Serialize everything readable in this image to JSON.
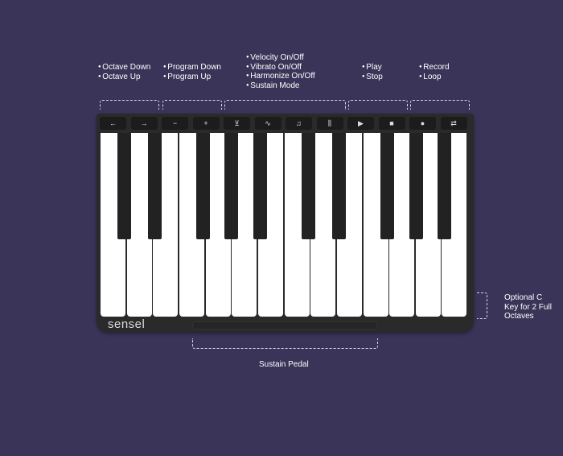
{
  "labels": {
    "octave": [
      "Octave Down",
      "Octave Up"
    ],
    "program": [
      "Program Down",
      "Program Up"
    ],
    "modes": [
      "Velocity On/Off",
      "Vibrato On/Off",
      "Harmonize On/Off",
      "Sustain Mode"
    ],
    "transport": [
      "Play",
      "Stop"
    ],
    "record": [
      "Record",
      "Loop"
    ],
    "optional_c": [
      "Optional C",
      "Key for 2 Full",
      "Octaves"
    ],
    "sustain_pedal": "Sustain Pedal"
  },
  "buttons": [
    {
      "icon": "arrow-left-icon",
      "glyph": "←"
    },
    {
      "icon": "arrow-right-icon",
      "glyph": "→"
    },
    {
      "icon": "minus-icon",
      "glyph": "−"
    },
    {
      "icon": "plus-icon",
      "glyph": "+"
    },
    {
      "icon": "velocity-icon",
      "glyph": "⊻"
    },
    {
      "icon": "vibrato-icon",
      "glyph": "∿"
    },
    {
      "icon": "harmonize-icon",
      "glyph": "♫"
    },
    {
      "icon": "sustain-icon",
      "glyph": "⫼"
    },
    {
      "icon": "play-icon",
      "glyph": "▶"
    },
    {
      "icon": "stop-icon",
      "glyph": "■"
    },
    {
      "icon": "record-icon",
      "glyph": "●"
    },
    {
      "icon": "loop-icon",
      "glyph": "⇄"
    }
  ],
  "logo": "sensel",
  "colors": {
    "background": "#3a3458",
    "device": "#2a2a2a"
  }
}
